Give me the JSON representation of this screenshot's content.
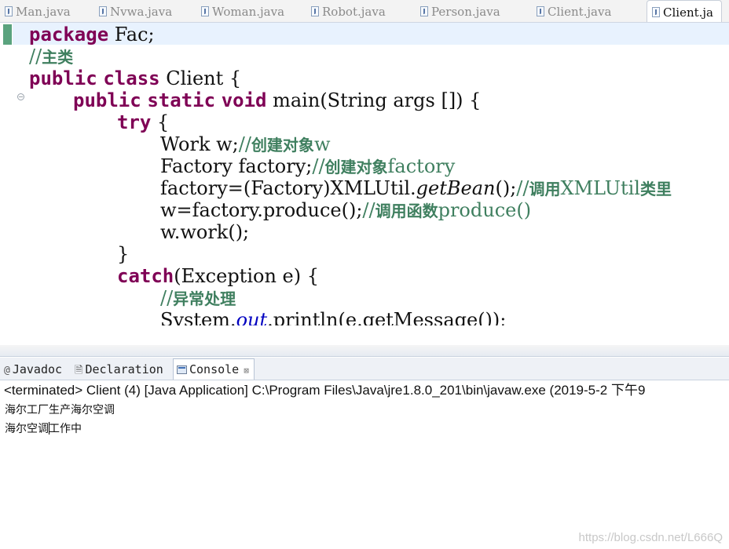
{
  "editor_tabs": [
    {
      "label": "Man.java"
    },
    {
      "label": "Nvwa.java"
    },
    {
      "label": "Woman.java"
    },
    {
      "label": "Robot.java"
    },
    {
      "label": "Person.java"
    },
    {
      "label": "Client.java"
    },
    {
      "label": "Client.ja",
      "active": true
    }
  ],
  "code": {
    "l1": {
      "kw": "package",
      "rest": " Fac;"
    },
    "l2": {
      "slashes": "//",
      "text": "主类"
    },
    "l3": {
      "kw1": "public",
      "kw2": "class",
      "rest": " Client {"
    },
    "l4": {
      "kw1": "public",
      "kw2": "static",
      "kw3": "void",
      "rest": " main(String args []) {"
    },
    "l5": {
      "kw": "try",
      "rest": " {"
    },
    "l6": {
      "code": "Work w;",
      "slashes": "//",
      "zh": "创建对象",
      "tail": "w"
    },
    "l7": {
      "code": "Factory factory;",
      "slashes": "//",
      "zh": "创建对象",
      "tail": "factory"
    },
    "l8": {
      "code1": "factory=(Factory)XMLUtil.",
      "italic": "getBean",
      "code2": "();",
      "slashes": "//",
      "zh1": "调用",
      "mid": "XMLUtil",
      "zh2": "类里"
    },
    "l9": {
      "code": "w=factory.produce();",
      "slashes": "//",
      "zh": "调用函数",
      "tail": "produce()"
    },
    "l10": {
      "code": "w.work();"
    },
    "l11": {
      "code": "}"
    },
    "l12": {
      "kw": "catch",
      "rest": "(Exception e) {"
    },
    "l13": {
      "slashes": "//",
      "zh": "异常处理"
    },
    "l14": {
      "code1": "System.",
      "field": "out",
      "code2": ".println(e.getMessage());"
    }
  },
  "scroll_arrow": "<",
  "view_tabs": [
    {
      "label": "Javadoc",
      "icon": "@"
    },
    {
      "label": "Declaration",
      "icon": "declaration-icon"
    },
    {
      "label": "Console",
      "icon": "console-icon",
      "active": true,
      "close": "⊠"
    }
  ],
  "console": {
    "header": "<terminated> Client (4) [Java Application] C:\\Program Files\\Java\\jre1.8.0_201\\bin\\javaw.exe (2019-5-2 下午9",
    "line1": "海尔工厂生产海尔空调",
    "line2a": "海尔空调",
    "line2b": "工作中"
  },
  "watermark": "https://blog.csdn.net/L666Q"
}
